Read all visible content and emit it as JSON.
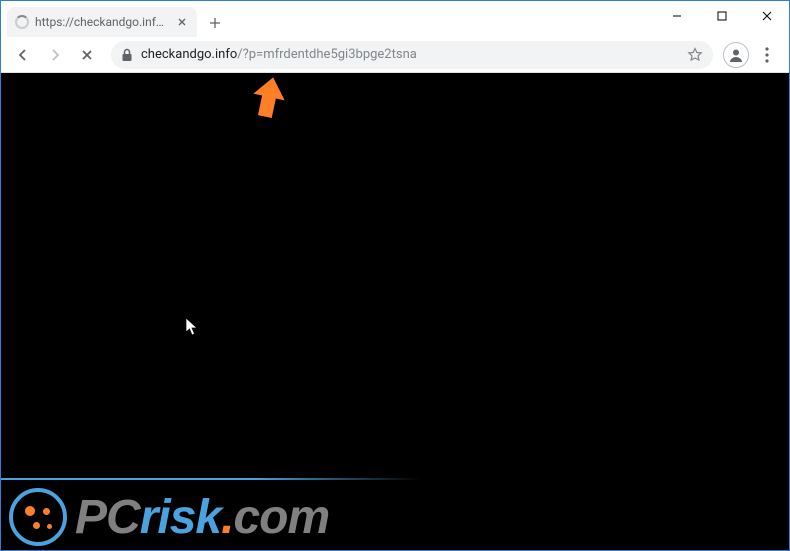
{
  "tab": {
    "title": "https://checkandgo.info/?p=mfr"
  },
  "url": {
    "host": "checkandgo.info",
    "path": "/?p=mfrdentdhe5gi3bpge2tsna"
  },
  "watermark": {
    "pc": "PC",
    "risk": "risk",
    "dot": ".",
    "com": "com"
  }
}
